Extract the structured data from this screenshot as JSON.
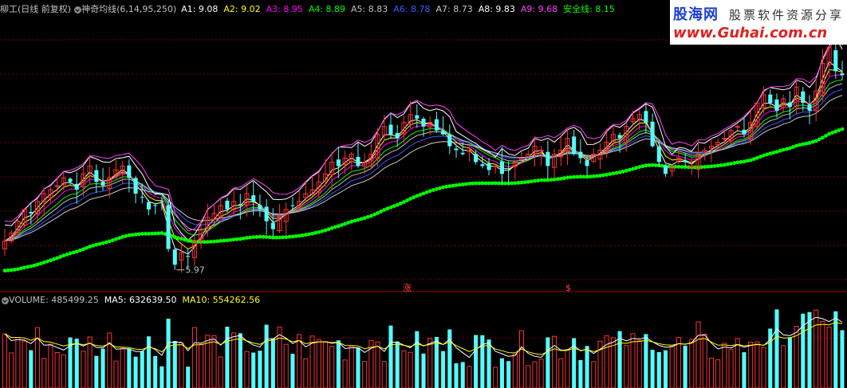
{
  "main_header": {
    "title": "柳工(日线 前复权)",
    "indicator": "神奇均线(6,14,95,250)",
    "lines": [
      {
        "label": "A1: 9.08",
        "color": "#ffffff"
      },
      {
        "label": "A2: 9.02",
        "color": "#ffff00"
      },
      {
        "label": "A3: 8.95",
        "color": "#ff00ff"
      },
      {
        "label": "A4: 8.89",
        "color": "#00ff00"
      },
      {
        "label": "A5: 8.83",
        "color": "#c0c0c0"
      },
      {
        "label": "A6: 8.78",
        "color": "#3a5cff"
      },
      {
        "label": "A7: 8.73",
        "color": "#c8c8c8"
      },
      {
        "label": "A8: 9.83",
        "color": "#ffffff"
      },
      {
        "label": "A9: 9.68",
        "color": "#ff40ff"
      },
      {
        "label": "安全线: 8.15",
        "color": "#00ff00"
      }
    ]
  },
  "volume_header": {
    "title": "VOLUME: 485499.25",
    "ma5": "MA5: 632639.50",
    "ma10": "MA10: 554262.56"
  },
  "annotations": {
    "low_label": "5.97",
    "marker1": "涨",
    "marker2": "$"
  },
  "logo": {
    "name": "股海网",
    "slogan": "股票软件资源分享",
    "url": "www.Guhai.com.cn"
  },
  "colors": {
    "up": "#ff3232",
    "down": "#54fcfc",
    "grid": "#800000",
    "safety": "#00ff00",
    "text": "#c0c0c0",
    "volume_ma5": "#ffffff",
    "volume_ma10": "#ffff00"
  },
  "chart_data": {
    "type": "candlestick",
    "closes": [
      6.7,
      6.9,
      7.2,
      7.5,
      7.4,
      7.7,
      7.9,
      8.0,
      8.1,
      8.3,
      8.2,
      8.0,
      8.4,
      8.6,
      8.2,
      8.1,
      8.3,
      8.5,
      8.6,
      8.3,
      7.9,
      7.8,
      7.5,
      7.6,
      7.7,
      6.5,
      6.1,
      6.4,
      6.3,
      6.7,
      7.0,
      7.3,
      7.4,
      7.6,
      7.5,
      7.7,
      7.6,
      7.9,
      7.7,
      7.5,
      7.2,
      7.0,
      7.3,
      7.5,
      7.6,
      7.7,
      7.9,
      8.0,
      8.2,
      8.4,
      8.7,
      8.6,
      8.8,
      8.9,
      8.6,
      8.7,
      8.9,
      9.4,
      9.6,
      9.4,
      9.3,
      9.7,
      9.9,
      9.8,
      9.6,
      9.7,
      9.5,
      9.4,
      9.1,
      9.0,
      8.9,
      9.0,
      8.7,
      8.6,
      8.5,
      8.6,
      8.4,
      8.5,
      8.7,
      8.8,
      8.9,
      9.1,
      9.0,
      8.6,
      8.9,
      9.0,
      9.3,
      8.9,
      8.8,
      8.6,
      8.9,
      9.0,
      9.2,
      9.4,
      9.3,
      9.6,
      9.8,
      9.9,
      9.7,
      9.1,
      8.7,
      8.4,
      8.6,
      8.8,
      8.7,
      8.6,
      8.9,
      9.0,
      9.1,
      9.2,
      9.3,
      9.5,
      9.6,
      9.4,
      9.7,
      10.2,
      10.4,
      10.2,
      10.0,
      10.3,
      10.1,
      10.6,
      10.2,
      10.0,
      10.5,
      11.2,
      11.6,
      11.0,
      10.9
    ],
    "y_range": [
      5.5,
      12.4
    ],
    "low_label_value": 5.97,
    "safety_line_value": 8.15,
    "volume_ma5": 632639.5,
    "volume_ma10": 554262.56,
    "volume_last": 485499.25
  }
}
